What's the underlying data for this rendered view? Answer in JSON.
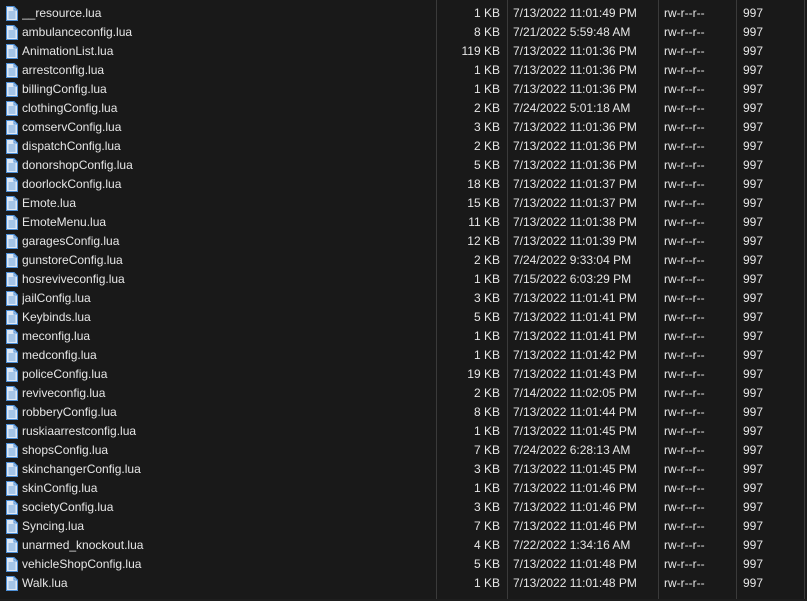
{
  "files": [
    {
      "name": "__resource.lua",
      "size": "1 KB",
      "modified": "7/13/2022 11:01:49 PM",
      "permissions": "rw-r--r--",
      "owner": "997"
    },
    {
      "name": "ambulanceconfig.lua",
      "size": "8 KB",
      "modified": "7/21/2022 5:59:48 AM",
      "permissions": "rw-r--r--",
      "owner": "997"
    },
    {
      "name": "AnimationList.lua",
      "size": "119 KB",
      "modified": "7/13/2022 11:01:36 PM",
      "permissions": "rw-r--r--",
      "owner": "997"
    },
    {
      "name": "arrestconfig.lua",
      "size": "1 KB",
      "modified": "7/13/2022 11:01:36 PM",
      "permissions": "rw-r--r--",
      "owner": "997"
    },
    {
      "name": "billingConfig.lua",
      "size": "1 KB",
      "modified": "7/13/2022 11:01:36 PM",
      "permissions": "rw-r--r--",
      "owner": "997"
    },
    {
      "name": "clothingConfig.lua",
      "size": "2 KB",
      "modified": "7/24/2022 5:01:18 AM",
      "permissions": "rw-r--r--",
      "owner": "997"
    },
    {
      "name": "comservConfig.lua",
      "size": "3 KB",
      "modified": "7/13/2022 11:01:36 PM",
      "permissions": "rw-r--r--",
      "owner": "997"
    },
    {
      "name": "dispatchConfig.lua",
      "size": "2 KB",
      "modified": "7/13/2022 11:01:36 PM",
      "permissions": "rw-r--r--",
      "owner": "997"
    },
    {
      "name": "donorshopConfig.lua",
      "size": "5 KB",
      "modified": "7/13/2022 11:01:36 PM",
      "permissions": "rw-r--r--",
      "owner": "997"
    },
    {
      "name": "doorlockConfig.lua",
      "size": "18 KB",
      "modified": "7/13/2022 11:01:37 PM",
      "permissions": "rw-r--r--",
      "owner": "997"
    },
    {
      "name": "Emote.lua",
      "size": "15 KB",
      "modified": "7/13/2022 11:01:37 PM",
      "permissions": "rw-r--r--",
      "owner": "997"
    },
    {
      "name": "EmoteMenu.lua",
      "size": "11 KB",
      "modified": "7/13/2022 11:01:38 PM",
      "permissions": "rw-r--r--",
      "owner": "997"
    },
    {
      "name": "garagesConfig.lua",
      "size": "12 KB",
      "modified": "7/13/2022 11:01:39 PM",
      "permissions": "rw-r--r--",
      "owner": "997"
    },
    {
      "name": "gunstoreConfig.lua",
      "size": "2 KB",
      "modified": "7/24/2022 9:33:04 PM",
      "permissions": "rw-r--r--",
      "owner": "997"
    },
    {
      "name": "hosreviveconfig.lua",
      "size": "1 KB",
      "modified": "7/15/2022 6:03:29 PM",
      "permissions": "rw-r--r--",
      "owner": "997"
    },
    {
      "name": "jailConfig.lua",
      "size": "3 KB",
      "modified": "7/13/2022 11:01:41 PM",
      "permissions": "rw-r--r--",
      "owner": "997"
    },
    {
      "name": "Keybinds.lua",
      "size": "5 KB",
      "modified": "7/13/2022 11:01:41 PM",
      "permissions": "rw-r--r--",
      "owner": "997"
    },
    {
      "name": "meconfig.lua",
      "size": "1 KB",
      "modified": "7/13/2022 11:01:41 PM",
      "permissions": "rw-r--r--",
      "owner": "997"
    },
    {
      "name": "medconfig.lua",
      "size": "1 KB",
      "modified": "7/13/2022 11:01:42 PM",
      "permissions": "rw-r--r--",
      "owner": "997"
    },
    {
      "name": "policeConfig.lua",
      "size": "19 KB",
      "modified": "7/13/2022 11:01:43 PM",
      "permissions": "rw-r--r--",
      "owner": "997"
    },
    {
      "name": "reviveconfig.lua",
      "size": "2 KB",
      "modified": "7/14/2022 11:02:05 PM",
      "permissions": "rw-r--r--",
      "owner": "997"
    },
    {
      "name": "robberyConfig.lua",
      "size": "8 KB",
      "modified": "7/13/2022 11:01:44 PM",
      "permissions": "rw-r--r--",
      "owner": "997"
    },
    {
      "name": "ruskiaarrestconfig.lua",
      "size": "1 KB",
      "modified": "7/13/2022 11:01:45 PM",
      "permissions": "rw-r--r--",
      "owner": "997"
    },
    {
      "name": "shopsConfig.lua",
      "size": "7 KB",
      "modified": "7/24/2022 6:28:13 AM",
      "permissions": "rw-r--r--",
      "owner": "997"
    },
    {
      "name": "skinchangerConfig.lua",
      "size": "3 KB",
      "modified": "7/13/2022 11:01:45 PM",
      "permissions": "rw-r--r--",
      "owner": "997"
    },
    {
      "name": "skinConfig.lua",
      "size": "1 KB",
      "modified": "7/13/2022 11:01:46 PM",
      "permissions": "rw-r--r--",
      "owner": "997"
    },
    {
      "name": "societyConfig.lua",
      "size": "3 KB",
      "modified": "7/13/2022 11:01:46 PM",
      "permissions": "rw-r--r--",
      "owner": "997"
    },
    {
      "name": "Syncing.lua",
      "size": "7 KB",
      "modified": "7/13/2022 11:01:46 PM",
      "permissions": "rw-r--r--",
      "owner": "997"
    },
    {
      "name": "unarmed_knockout.lua",
      "size": "4 KB",
      "modified": "7/22/2022 1:34:16 AM",
      "permissions": "rw-r--r--",
      "owner": "997"
    },
    {
      "name": "vehicleShopConfig.lua",
      "size": "5 KB",
      "modified": "7/13/2022 11:01:48 PM",
      "permissions": "rw-r--r--",
      "owner": "997"
    },
    {
      "name": "Walk.lua",
      "size": "1 KB",
      "modified": "7/13/2022 11:01:48 PM",
      "permissions": "rw-r--r--",
      "owner": "997"
    }
  ],
  "icons": {
    "file": "lua-file-icon"
  },
  "colors": {
    "background": "#191919",
    "text": "#e6e6e6",
    "separator": "#3a3a3a",
    "icon_fill": "#dfe9f5",
    "icon_stroke": "#4d8fd6"
  }
}
